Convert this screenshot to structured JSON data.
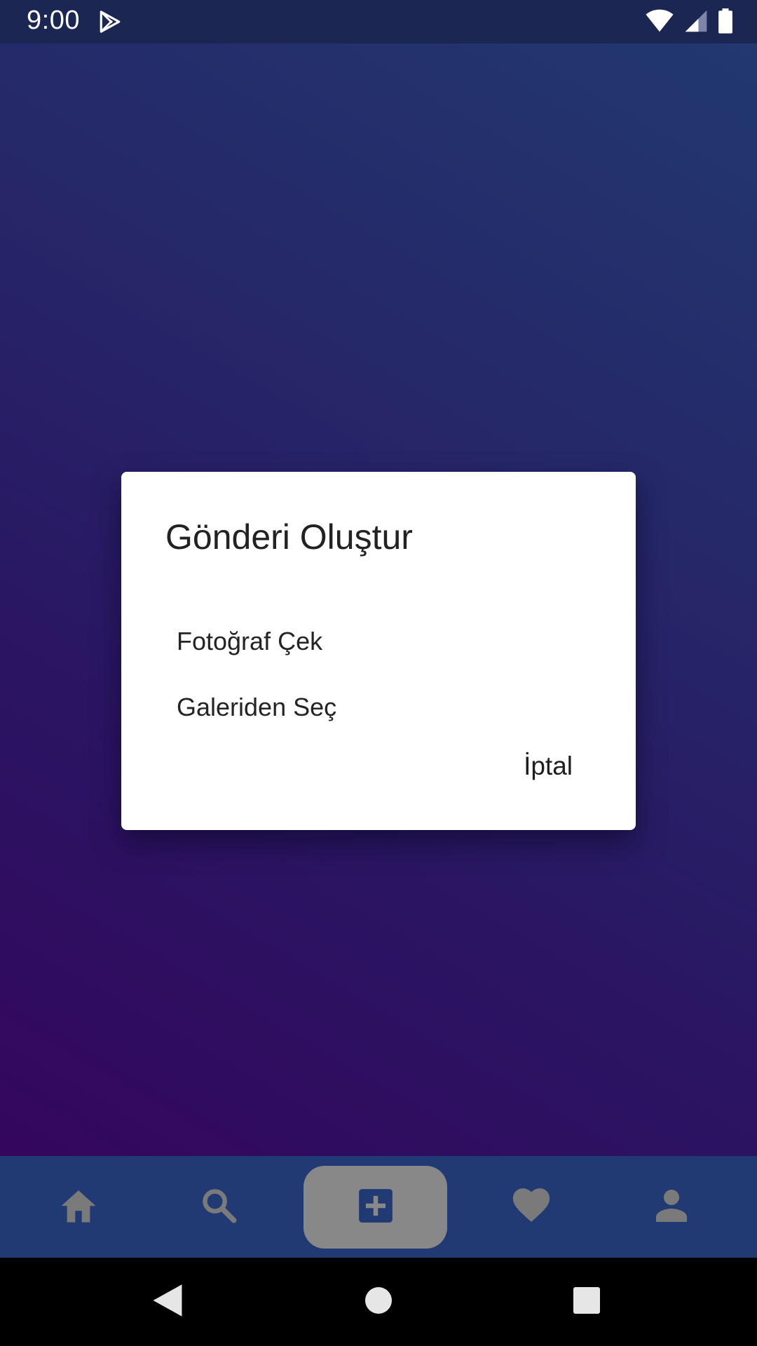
{
  "status_bar": {
    "time": "9:00",
    "icons": [
      "play-store-icon",
      "wifi-icon",
      "signal-icon",
      "battery-icon"
    ]
  },
  "dialog": {
    "title": "Gönderi Oluştur",
    "options": [
      {
        "label": "Fotoğraf Çek"
      },
      {
        "label": "Galeriden Seç"
      }
    ],
    "cancel_label": "İptal"
  },
  "bottom_nav": {
    "items": [
      {
        "icon": "home-icon",
        "selected": false
      },
      {
        "icon": "search-icon",
        "selected": false
      },
      {
        "icon": "add-box-icon",
        "selected": true
      },
      {
        "icon": "heart-icon",
        "selected": false
      },
      {
        "icon": "person-icon",
        "selected": false
      }
    ],
    "colors": {
      "bar": "#213a73",
      "icon": "#7a7a7a",
      "selected_bg": "#888888",
      "selected_icon": "#213a73"
    }
  },
  "system_nav": {
    "buttons": [
      "back-icon",
      "home-circle-icon",
      "recents-icon"
    ]
  },
  "colors": {
    "status_bar": "#1b2652",
    "background_gradient": [
      "#34065e",
      "#22386f"
    ],
    "dialog_bg": "#ffffff"
  }
}
